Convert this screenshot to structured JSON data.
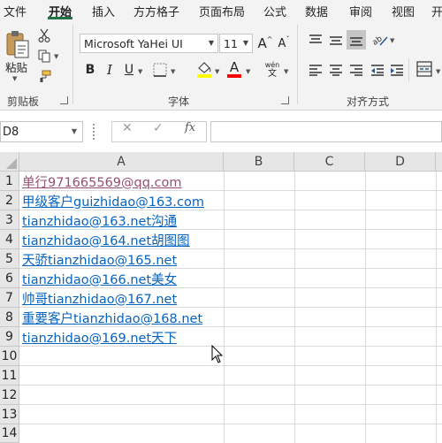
{
  "tabs": [
    "文件",
    "开始",
    "插入",
    "方方格子",
    "页面布局",
    "公式",
    "数据",
    "审阅",
    "视图",
    "开"
  ],
  "active_tab": "开始",
  "clipboard": {
    "paste_label": "粘贴",
    "group_label": "剪贴板"
  },
  "font": {
    "name": "Microsoft YaHei UI",
    "size": "11",
    "grow_label": "A",
    "shrink_label": "A",
    "bold_label": "B",
    "italic_label": "I",
    "underline_label": "U",
    "font_color_label": "A",
    "phonetic_top": "wén",
    "phonetic_bottom": "文",
    "group_label": "字体"
  },
  "alignment": {
    "group_label": "对齐方式"
  },
  "formula_bar": {
    "name_box": "D8",
    "cancel_symbol": "✕",
    "enter_symbol": "✓",
    "fx_label": "fx",
    "formula_value": ""
  },
  "columns": [
    "A",
    "B",
    "C",
    "D"
  ],
  "rows": [
    "1",
    "2",
    "3",
    "4",
    "5",
    "6",
    "7",
    "8",
    "9",
    "10",
    "11",
    "12",
    "13",
    "14"
  ],
  "cells_a": [
    "单行971665569@qq.com",
    "甲级客户guizhidao@163.com",
    "tianzhidao@163.net沟通",
    "tianzhidao@164.net胡图图",
    "天骄tianzhidao@165.net",
    "tianzhidao@166.net美女",
    "帅哥tianzhidao@167.net",
    "重要客户tianzhidao@168.net",
    "tianzhidao@169.net天下"
  ],
  "colors": {
    "accent": "#217346",
    "hyperlink": "#0563c1",
    "visited_link": "#954f72",
    "fill_highlight": "#ffff00",
    "font_color": "#ff0000"
  },
  "icons": [
    "paste-icon",
    "cut-icon",
    "copy-icon",
    "format-painter-icon",
    "fill-color-icon",
    "borders-icon",
    "font-color-icon",
    "align-top-icon",
    "align-middle-icon",
    "align-bottom-icon",
    "orientation-icon",
    "align-left-icon",
    "align-center-icon",
    "align-right-icon",
    "decrease-indent-icon",
    "increase-indent-icon",
    "wrap-merge-icon",
    "mouse-cursor-icon"
  ]
}
